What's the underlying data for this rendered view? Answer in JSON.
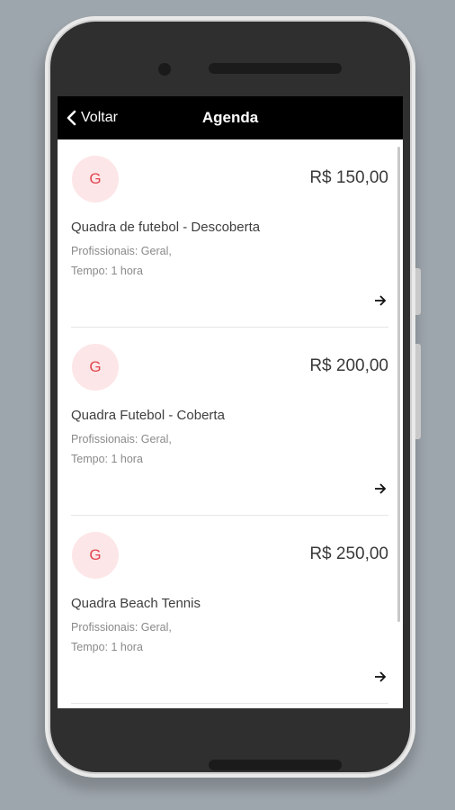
{
  "header": {
    "back_label": "Voltar",
    "title": "Agenda"
  },
  "items": [
    {
      "avatar": "G",
      "price": "R$ 150,00",
      "name": "Quadra de futebol - Descoberta",
      "professionals": "Profissionais: Geral,",
      "duration": "Tempo: 1 hora"
    },
    {
      "avatar": "G",
      "price": "R$ 200,00",
      "name": "Quadra Futebol - Coberta",
      "professionals": "Profissionais: Geral,",
      "duration": "Tempo: 1 hora"
    },
    {
      "avatar": "G",
      "price": "R$ 250,00",
      "name": "Quadra Beach Tennis",
      "professionals": "Profissionais: Geral,",
      "duration": "Tempo: 1 hora"
    }
  ],
  "colors": {
    "topbar": "#000000",
    "avatar_bg": "#fde6e8",
    "avatar_text": "#e0474f",
    "background": "#9ea6ad"
  }
}
